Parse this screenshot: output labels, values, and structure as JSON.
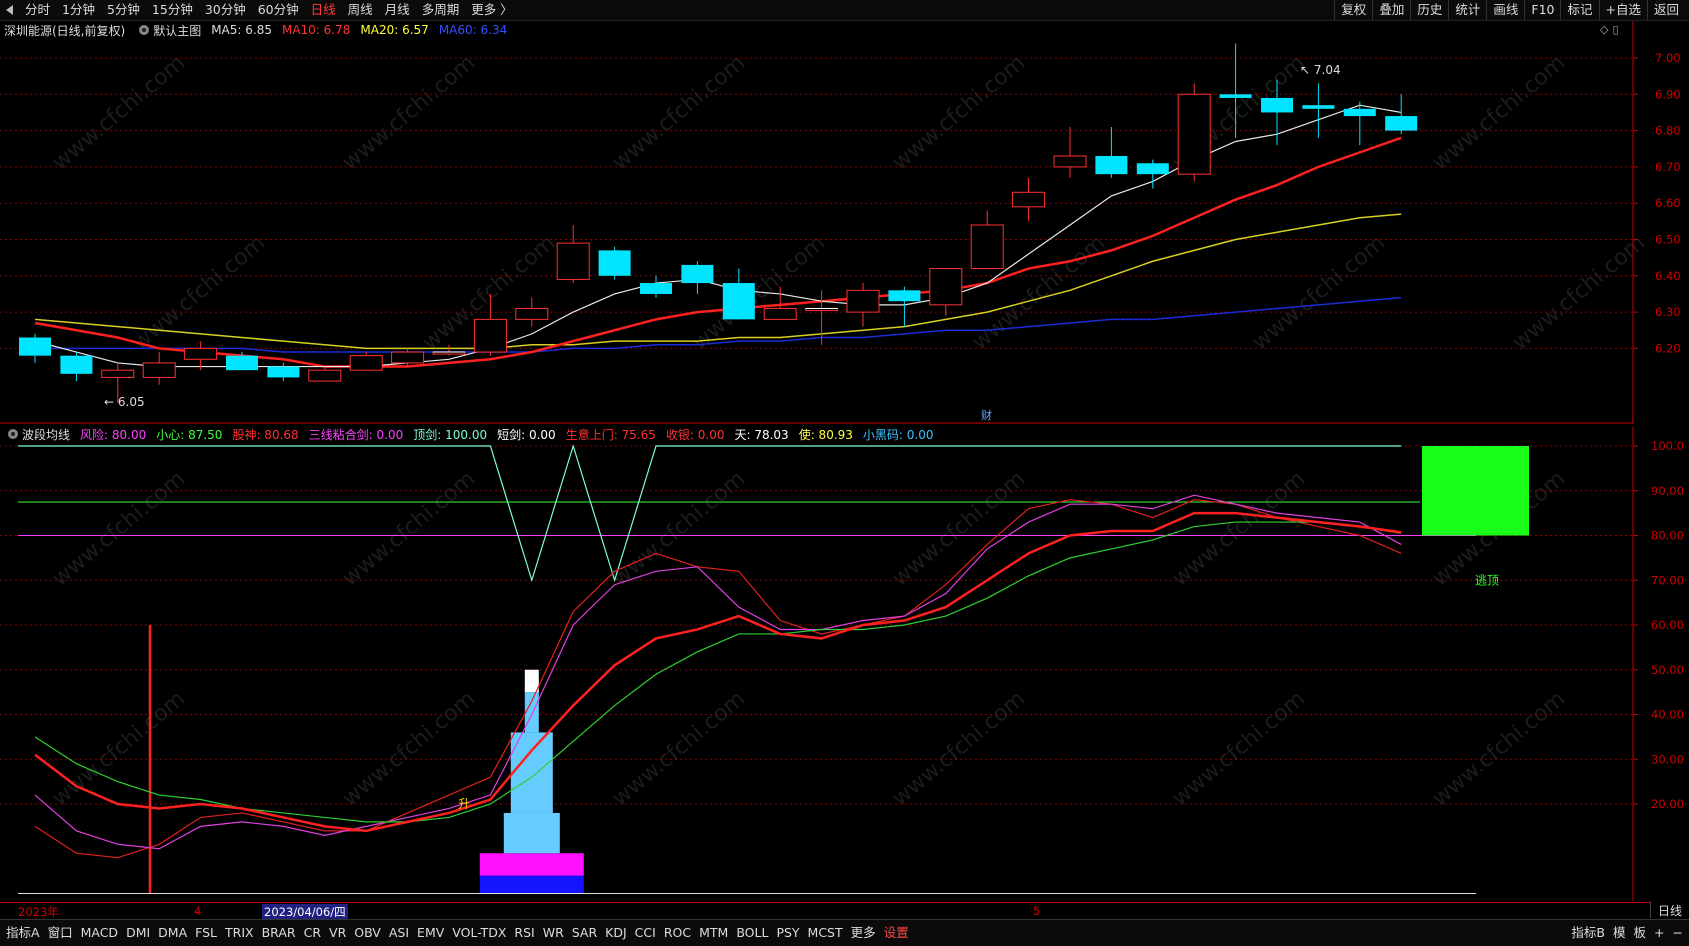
{
  "toolbar": {
    "periods": [
      "分时",
      "1分钟",
      "5分钟",
      "15分钟",
      "30分钟",
      "60分钟",
      "日线",
      "周线",
      "月线",
      "多周期",
      "更多 〉"
    ],
    "active_period": "日线",
    "right_buttons": [
      "复权",
      "叠加",
      "历史",
      "统计",
      "画线",
      "F10",
      "标记",
      "+自选",
      "返回"
    ]
  },
  "main_legend": {
    "stock": "深圳能源(日线,前复权)",
    "template": "默认主图",
    "ma5": "MA5: 6.85",
    "ma10": "MA10: 6.78",
    "ma20": "MA20: 6.57",
    "ma60": "MA60: 6.34"
  },
  "indicator_legend": {
    "name": "波段均线",
    "items": [
      {
        "text": "风险: 80.00",
        "color": "#ff40ff"
      },
      {
        "text": "小心: 87.50",
        "color": "#40ff40"
      },
      {
        "text": "股神: 80.68",
        "color": "#ff3030"
      },
      {
        "text": "三线粘合剑: 0.00",
        "color": "#ff40ff"
      },
      {
        "text": "顶剑: 100.00",
        "color": "#7fffd4"
      },
      {
        "text": "短剑: 0.00",
        "color": "#ffffff"
      },
      {
        "text": "生意上门: 75.65",
        "color": "#ff3030"
      },
      {
        "text": "收银: 0.00",
        "color": "#ff3030"
      },
      {
        "text": "天: 78.03",
        "color": "#ffffff"
      },
      {
        "text": "使: 80.93",
        "color": "#ffff40"
      },
      {
        "text": "小黑码: 0.00",
        "color": "#40c0ff"
      }
    ]
  },
  "price_axis": [
    "7.00",
    "6.90",
    "6.80",
    "6.70",
    "6.60",
    "6.50",
    "6.40",
    "6.30",
    "6.20"
  ],
  "ind_axis": [
    "100.0",
    "90.00",
    "80.00",
    "70.00",
    "60.00",
    "50.00",
    "40.00",
    "30.00",
    "20.00"
  ],
  "annotations": {
    "high": "7.04",
    "low": "6.05",
    "cai": "财",
    "sheng": "升",
    "taoding": "逃顶"
  },
  "date_axis": {
    "year": "2023年",
    "m4": "4",
    "sel": "2023/04/06/四",
    "m5": "5"
  },
  "bottom_tabs": [
    "指标A",
    "窗口",
    "MACD",
    "DMI",
    "DMA",
    "FSL",
    "TRIX",
    "BRAR",
    "CR",
    "VR",
    "OBV",
    "ASI",
    "EMV",
    "VOL-TDX",
    "RSI",
    "WR",
    "SAR",
    "KDJ",
    "CCI",
    "ROC",
    "MTM",
    "BOLL",
    "PSY",
    "MCST",
    "更多",
    "设置"
  ],
  "bottom_right": [
    "指标B",
    "模",
    "板",
    "+",
    "−"
  ],
  "period_right": "日线",
  "watermark": "www.cfchi.com",
  "chart_data": {
    "type": "candlestick",
    "price_ylim": [
      6.0,
      7.1
    ],
    "candles": [
      {
        "o": 6.18,
        "c": 6.23,
        "h": 6.24,
        "l": 6.16,
        "up": false
      },
      {
        "o": 6.13,
        "c": 6.18,
        "h": 6.19,
        "l": 6.11,
        "up": false
      },
      {
        "o": 6.12,
        "c": 6.14,
        "h": 6.16,
        "l": 6.05,
        "up": true
      },
      {
        "o": 6.12,
        "c": 6.16,
        "h": 6.19,
        "l": 6.1,
        "up": true
      },
      {
        "o": 6.17,
        "c": 6.2,
        "h": 6.22,
        "l": 6.14,
        "up": true
      },
      {
        "o": 6.14,
        "c": 6.18,
        "h": 6.19,
        "l": 6.14,
        "up": false
      },
      {
        "o": 6.12,
        "c": 6.15,
        "h": 6.16,
        "l": 6.11,
        "up": false
      },
      {
        "o": 6.11,
        "c": 6.14,
        "h": 6.15,
        "l": 6.11,
        "up": true
      },
      {
        "o": 6.14,
        "c": 6.18,
        "h": 6.19,
        "l": 6.14,
        "up": true
      },
      {
        "o": 6.16,
        "c": 6.19,
        "h": 6.2,
        "l": 6.15,
        "up": true
      },
      {
        "o": 6.19,
        "c": 6.19,
        "h": 6.21,
        "l": 6.18,
        "up": true
      },
      {
        "o": 6.19,
        "c": 6.28,
        "h": 6.35,
        "l": 6.18,
        "up": true
      },
      {
        "o": 6.28,
        "c": 6.31,
        "h": 6.34,
        "l": 6.26,
        "up": true
      },
      {
        "o": 6.39,
        "c": 6.49,
        "h": 6.54,
        "l": 6.38,
        "up": true
      },
      {
        "o": 6.47,
        "c": 6.4,
        "h": 6.48,
        "l": 6.39,
        "up": false
      },
      {
        "o": 6.38,
        "c": 6.35,
        "h": 6.4,
        "l": 6.34,
        "up": false
      },
      {
        "o": 6.43,
        "c": 6.38,
        "h": 6.44,
        "l": 6.35,
        "up": false
      },
      {
        "o": 6.38,
        "c": 6.28,
        "h": 6.42,
        "l": 6.28,
        "up": false
      },
      {
        "o": 6.28,
        "c": 6.31,
        "h": 6.37,
        "l": 6.28,
        "up": true
      },
      {
        "o": 6.31,
        "c": 6.31,
        "h": 6.36,
        "l": 6.21,
        "up": true
      },
      {
        "o": 6.3,
        "c": 6.36,
        "h": 6.38,
        "l": 6.26,
        "up": true
      },
      {
        "o": 6.36,
        "c": 6.33,
        "h": 6.37,
        "l": 6.26,
        "up": false
      },
      {
        "o": 6.32,
        "c": 6.42,
        "h": 6.42,
        "l": 6.29,
        "up": true
      },
      {
        "o": 6.42,
        "c": 6.54,
        "h": 6.58,
        "l": 6.42,
        "up": true
      },
      {
        "o": 6.59,
        "c": 6.63,
        "h": 6.67,
        "l": 6.55,
        "up": true
      },
      {
        "o": 6.7,
        "c": 6.73,
        "h": 6.81,
        "l": 6.67,
        "up": true
      },
      {
        "o": 6.73,
        "c": 6.68,
        "h": 6.81,
        "l": 6.67,
        "up": false
      },
      {
        "o": 6.71,
        "c": 6.68,
        "h": 6.72,
        "l": 6.64,
        "up": false
      },
      {
        "o": 6.68,
        "c": 6.9,
        "h": 6.93,
        "l": 6.66,
        "up": true
      },
      {
        "o": 6.89,
        "c": 6.9,
        "h": 7.04,
        "l": 6.78,
        "up": false
      },
      {
        "o": 6.89,
        "c": 6.85,
        "h": 6.94,
        "l": 6.76,
        "up": false
      },
      {
        "o": 6.87,
        "c": 6.86,
        "h": 6.93,
        "l": 6.78,
        "up": false
      },
      {
        "o": 6.86,
        "c": 6.84,
        "h": 6.88,
        "l": 6.76,
        "up": false
      },
      {
        "o": 6.84,
        "c": 6.8,
        "h": 6.9,
        "l": 6.79,
        "up": false
      }
    ],
    "ma5": [
      6.22,
      6.19,
      6.16,
      6.15,
      6.15,
      6.15,
      6.15,
      6.15,
      6.15,
      6.16,
      6.17,
      6.2,
      6.24,
      6.3,
      6.35,
      6.38,
      6.39,
      6.36,
      6.35,
      6.33,
      6.32,
      6.32,
      6.34,
      6.38,
      6.46,
      6.54,
      6.62,
      6.66,
      6.72,
      6.77,
      6.79,
      6.83,
      6.87,
      6.85
    ],
    "ma10": [
      6.27,
      6.25,
      6.23,
      6.2,
      6.19,
      6.18,
      6.17,
      6.15,
      6.15,
      6.15,
      6.16,
      6.17,
      6.19,
      6.22,
      6.25,
      6.28,
      6.3,
      6.31,
      6.32,
      6.33,
      6.34,
      6.35,
      6.36,
      6.38,
      6.42,
      6.44,
      6.47,
      6.51,
      6.56,
      6.61,
      6.65,
      6.7,
      6.74,
      6.78
    ],
    "ma20": [
      6.28,
      6.27,
      6.26,
      6.25,
      6.24,
      6.23,
      6.22,
      6.21,
      6.2,
      6.2,
      6.2,
      6.2,
      6.21,
      6.21,
      6.22,
      6.22,
      6.22,
      6.23,
      6.23,
      6.24,
      6.25,
      6.26,
      6.28,
      6.3,
      6.33,
      6.36,
      6.4,
      6.44,
      6.47,
      6.5,
      6.52,
      6.54,
      6.56,
      6.57
    ],
    "ma60": [
      6.2,
      6.2,
      6.2,
      6.2,
      6.2,
      6.2,
      6.19,
      6.19,
      6.19,
      6.19,
      6.19,
      6.19,
      6.19,
      6.2,
      6.2,
      6.21,
      6.21,
      6.22,
      6.22,
      6.23,
      6.23,
      6.24,
      6.25,
      6.25,
      6.26,
      6.27,
      6.28,
      6.28,
      6.29,
      6.3,
      6.31,
      6.32,
      6.33,
      6.34
    ],
    "ind_ylim": [
      0,
      100
    ],
    "ind_lines": {
      "green": [
        35,
        29,
        25,
        22,
        21,
        19,
        18,
        17,
        16,
        16,
        17,
        20,
        26,
        34,
        42,
        49,
        54,
        58,
        58,
        59,
        59,
        60,
        62,
        66,
        71,
        75,
        77,
        79,
        82,
        83,
        83,
        83,
        82,
        80.5
      ],
      "red_thick": [
        31,
        24,
        20,
        19,
        20,
        19,
        17,
        15,
        14,
        16,
        18,
        21,
        32,
        42,
        51,
        57,
        59,
        62,
        58,
        57,
        60,
        61,
        64,
        70,
        76,
        80,
        81,
        81,
        85,
        85,
        84,
        83,
        82,
        80.7
      ],
      "magenta": [
        22,
        14,
        11,
        10,
        15,
        16,
        15,
        13,
        15,
        17,
        19,
        22,
        40,
        60,
        69,
        72,
        73,
        64,
        59,
        59,
        61,
        62,
        67,
        77,
        83,
        87,
        87,
        86,
        89,
        87,
        85,
        84,
        83,
        78
      ],
      "red_thin": [
        15,
        9,
        8,
        11,
        17,
        18,
        16,
        14,
        14,
        18,
        22,
        26,
        43,
        63,
        72,
        76,
        73,
        72,
        61,
        58,
        60,
        62,
        69,
        78,
        86,
        88,
        87,
        84,
        88,
        87,
        84,
        82,
        80,
        76
      ],
      "aqua": [
        100,
        100,
        100,
        100,
        100,
        100,
        100,
        100,
        100,
        100,
        100,
        100,
        70,
        100,
        70,
        100,
        100,
        100,
        100,
        100,
        100,
        100,
        100,
        100,
        100,
        100,
        100,
        100,
        100,
        100,
        100,
        100,
        100,
        100
      ]
    },
    "ind_hlines": {
      "green": 87.5,
      "magenta": 80
    },
    "sheng_bar": {
      "layers": [
        {
          "from": 0,
          "to": 4,
          "color": "#1414ff"
        },
        {
          "from": 4,
          "to": 9,
          "color": "#ff10ff"
        },
        {
          "from": 9,
          "to": 18,
          "color": "#66ccff"
        },
        {
          "from": 18,
          "to": 36,
          "color": "#66ccff"
        },
        {
          "from": 36,
          "to": 45,
          "color": "#66ccff"
        },
        {
          "from": 45,
          "to": 50,
          "color": "#ffffff"
        }
      ]
    }
  }
}
